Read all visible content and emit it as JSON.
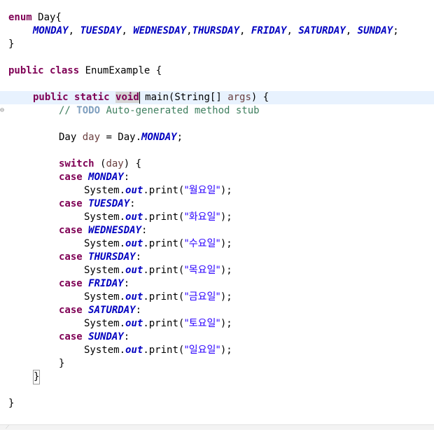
{
  "editor": {
    "tokens": {
      "enum_kw": "enum",
      "day_decl": " Day{",
      "monday": "MONDAY",
      "tuesday": "TUESDAY",
      "wednesday": "WEDNESDAY",
      "thursday": "THURSDAY",
      "friday": "FRIDAY",
      "saturday": "SATURDAY",
      "sunday": "SUNDAY",
      "comma": ", ",
      "comma_nospace": ",",
      "semicolon": ";",
      "close_brace": "}",
      "public_kw": "public",
      "class_kw": "class",
      "class_name": " EnumExample {",
      "static_kw": "static",
      "void_kw": "void",
      "main_sig": " main(String[] ",
      "args": "args",
      "main_end": ") {",
      "comment_prefix": "// ",
      "todo": "TODO",
      "comment_rest": " Auto-generated method stub",
      "day_type": "Day ",
      "day_var": "day",
      "assign": " = Day.",
      "switch_kw": "switch",
      "switch_open": " (",
      "switch_close": ") {",
      "case_kw": "case",
      "colon": ":",
      "system": "System.",
      "out": "out",
      "print_open": ".print(",
      "print_close": ");",
      "str_mon": "\"월요일\"",
      "str_tue": "\"화요일\"",
      "str_wed": "\"수요일\"",
      "str_thu": "\"목요일\"",
      "str_fri": "\"금요일\"",
      "str_sat": "\"토요일\"",
      "str_sun": "\"일요일\""
    },
    "fold_marker": "⊖"
  },
  "colors": {
    "keyword": "#7f0055",
    "enum_constant": "#0000c0",
    "comment": "#3f7f5f",
    "string": "#2a00ff",
    "current_line": "#e8f2fe"
  }
}
